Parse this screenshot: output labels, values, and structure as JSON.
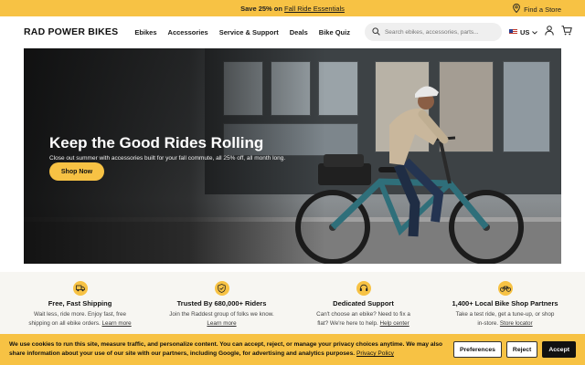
{
  "promo": {
    "text": "Save 25% on ",
    "link": "Fall Ride Essentials",
    "store_link": "Find a Store"
  },
  "header": {
    "logo": "RAD POWER BIKES",
    "nav": [
      "Ebikes",
      "Accessories",
      "Service & Support",
      "Deals",
      "Bike Quiz"
    ],
    "search_placeholder": "Search ebikes, accessories, parts...",
    "locale": "US"
  },
  "hero": {
    "title": "Keep the Good Rides Rolling",
    "subtitle": "Close out summer with accessories built for your fall commute, all 25% off, all month long.",
    "cta": "Shop Now"
  },
  "features": [
    {
      "icon": "truck-icon",
      "title": "Free, Fast Shipping",
      "desc": "Wait less, ride more. Enjoy fast, free shipping on all ebike orders.",
      "link": "Learn more"
    },
    {
      "icon": "shield-check-icon",
      "title": "Trusted By 680,000+ Riders",
      "desc": "Join the Raddest group of folks we know.",
      "link": "Learn more"
    },
    {
      "icon": "support-headset-icon",
      "title": "Dedicated Support",
      "desc": "Can't choose an ebike? Need to fix a flat? We're here to help.",
      "link": "Help center"
    },
    {
      "icon": "bike-icon",
      "title": "1,400+ Local Bike Shop Partners",
      "desc": "Take a test ride, get a tune-up, or shop in-store.",
      "link": "Store locator"
    }
  ],
  "cookie": {
    "text": "We use cookies to run this site, measure traffic, and personalize content. You can accept, reject, or manage your privacy choices anytime. We may also share information about your use of our site with our partners, including Google, for advertising and analytics purposes. ",
    "link": "Privacy Policy",
    "preferences": "Preferences",
    "reject": "Reject",
    "accept": "Accept"
  },
  "colors": {
    "brand_yellow": "#f7c244",
    "dark": "#111111"
  }
}
